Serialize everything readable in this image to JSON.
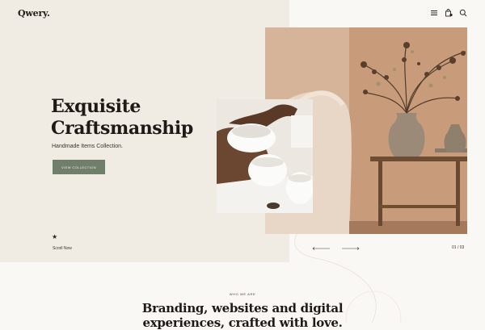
{
  "header": {
    "logo": "Qwery.",
    "icons": [
      "menu-icon",
      "cart-icon",
      "search-icon"
    ]
  },
  "hero": {
    "title_line1": "Exquisite",
    "title_line2": "Craftsmanship",
    "subtitle": "Handmade Items Collection.",
    "cta_label": "VIEW COLLECTION",
    "scroll_label": "Scroll Now",
    "slide_counter": "01 / 03"
  },
  "about": {
    "eyebrow": "WHO WE ARE",
    "title_line1": "Branding, websites and digital",
    "title_line2": "experiences, crafted with love."
  },
  "colors": {
    "background": "#faf8f4",
    "hero_panel": "#f0ebe3",
    "cta": "#6f7f69",
    "text": "#1f1a16"
  }
}
